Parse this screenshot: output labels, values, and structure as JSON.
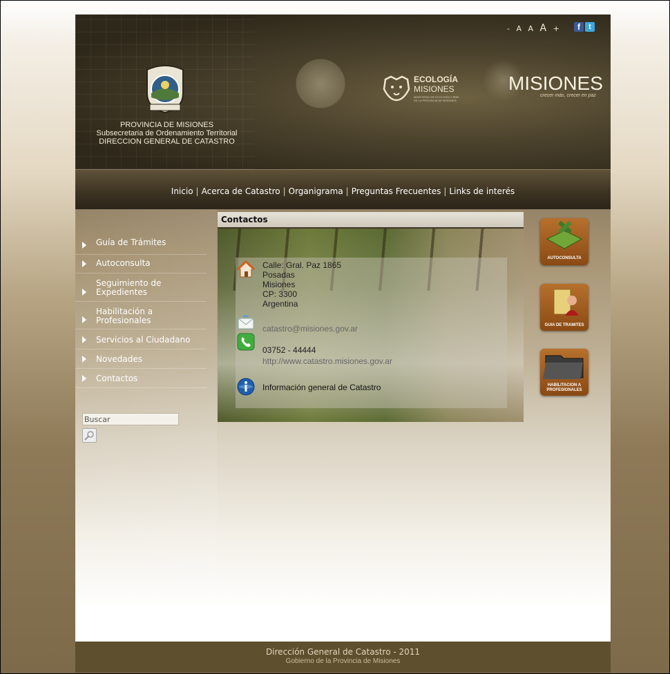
{
  "header": {
    "font_tools": {
      "minus": "-",
      "a1": "A",
      "a2": "A",
      "a3": "A",
      "plus": "+"
    },
    "social": {
      "facebook": "f",
      "twitter": "t"
    },
    "province_lines": [
      "PROVINCIA DE MISIONES",
      "Subsecretaria de Ordenamiento Territorial",
      "DIRECCION GENERAL DE CATASTRO"
    ],
    "seal_text": "PROVINCIA DE MISIONES",
    "ecologia": {
      "line1": "ECOLOGÍA",
      "line2": "MISIONES",
      "line3": "MINISTERIO DE ECOLOGÍA Y RNR DE LA PROVINCIA DE MISIONES"
    },
    "misiones": {
      "name": "MISIONES",
      "tagline": "crecer más, crecer en paz"
    }
  },
  "nav": {
    "items": [
      {
        "label": "Inicio"
      },
      {
        "label": "Acerca de Catastro"
      },
      {
        "label": "Organigrama"
      },
      {
        "label": "Preguntas Frecuentes"
      },
      {
        "label": "Links de interés"
      }
    ],
    "separator": "|"
  },
  "sidebar": {
    "items": [
      {
        "label": "Guía de Trámites"
      },
      {
        "label": "Autoconsulta"
      },
      {
        "label": "Seguimiento de Expedientes"
      },
      {
        "label": "Habilitación a Profesionales"
      },
      {
        "label": "Servicios al Ciudadano"
      },
      {
        "label": "Novedades"
      },
      {
        "label": "Contactos"
      }
    ],
    "search_value": "Buscar"
  },
  "content": {
    "title": "Contactos",
    "address": [
      "Calle: Gral. Paz 1865",
      "Posadas",
      "Misiones",
      "CP: 3300",
      "Argentina"
    ],
    "email": "catastro@misiones.gov.ar",
    "phone": "03752 - 44444",
    "website": "http://www.catastro.misiones.gov.ar",
    "general_info": "Información general de Catastro"
  },
  "right_buttons": [
    {
      "label": "AUTOCONSULTA"
    },
    {
      "label": "GUIA DE TRAMITES"
    },
    {
      "label": "HABILITACION A PROFESIONALES"
    }
  ],
  "footer": {
    "line1": "Dirección General de Catastro - 2011",
    "line2": "Gobierno de la Provincia de Misiones"
  },
  "colors": {
    "footer_bg": "#5e4f2e",
    "nav_bg": "#3b3221",
    "button_orange": "#a35f22"
  }
}
